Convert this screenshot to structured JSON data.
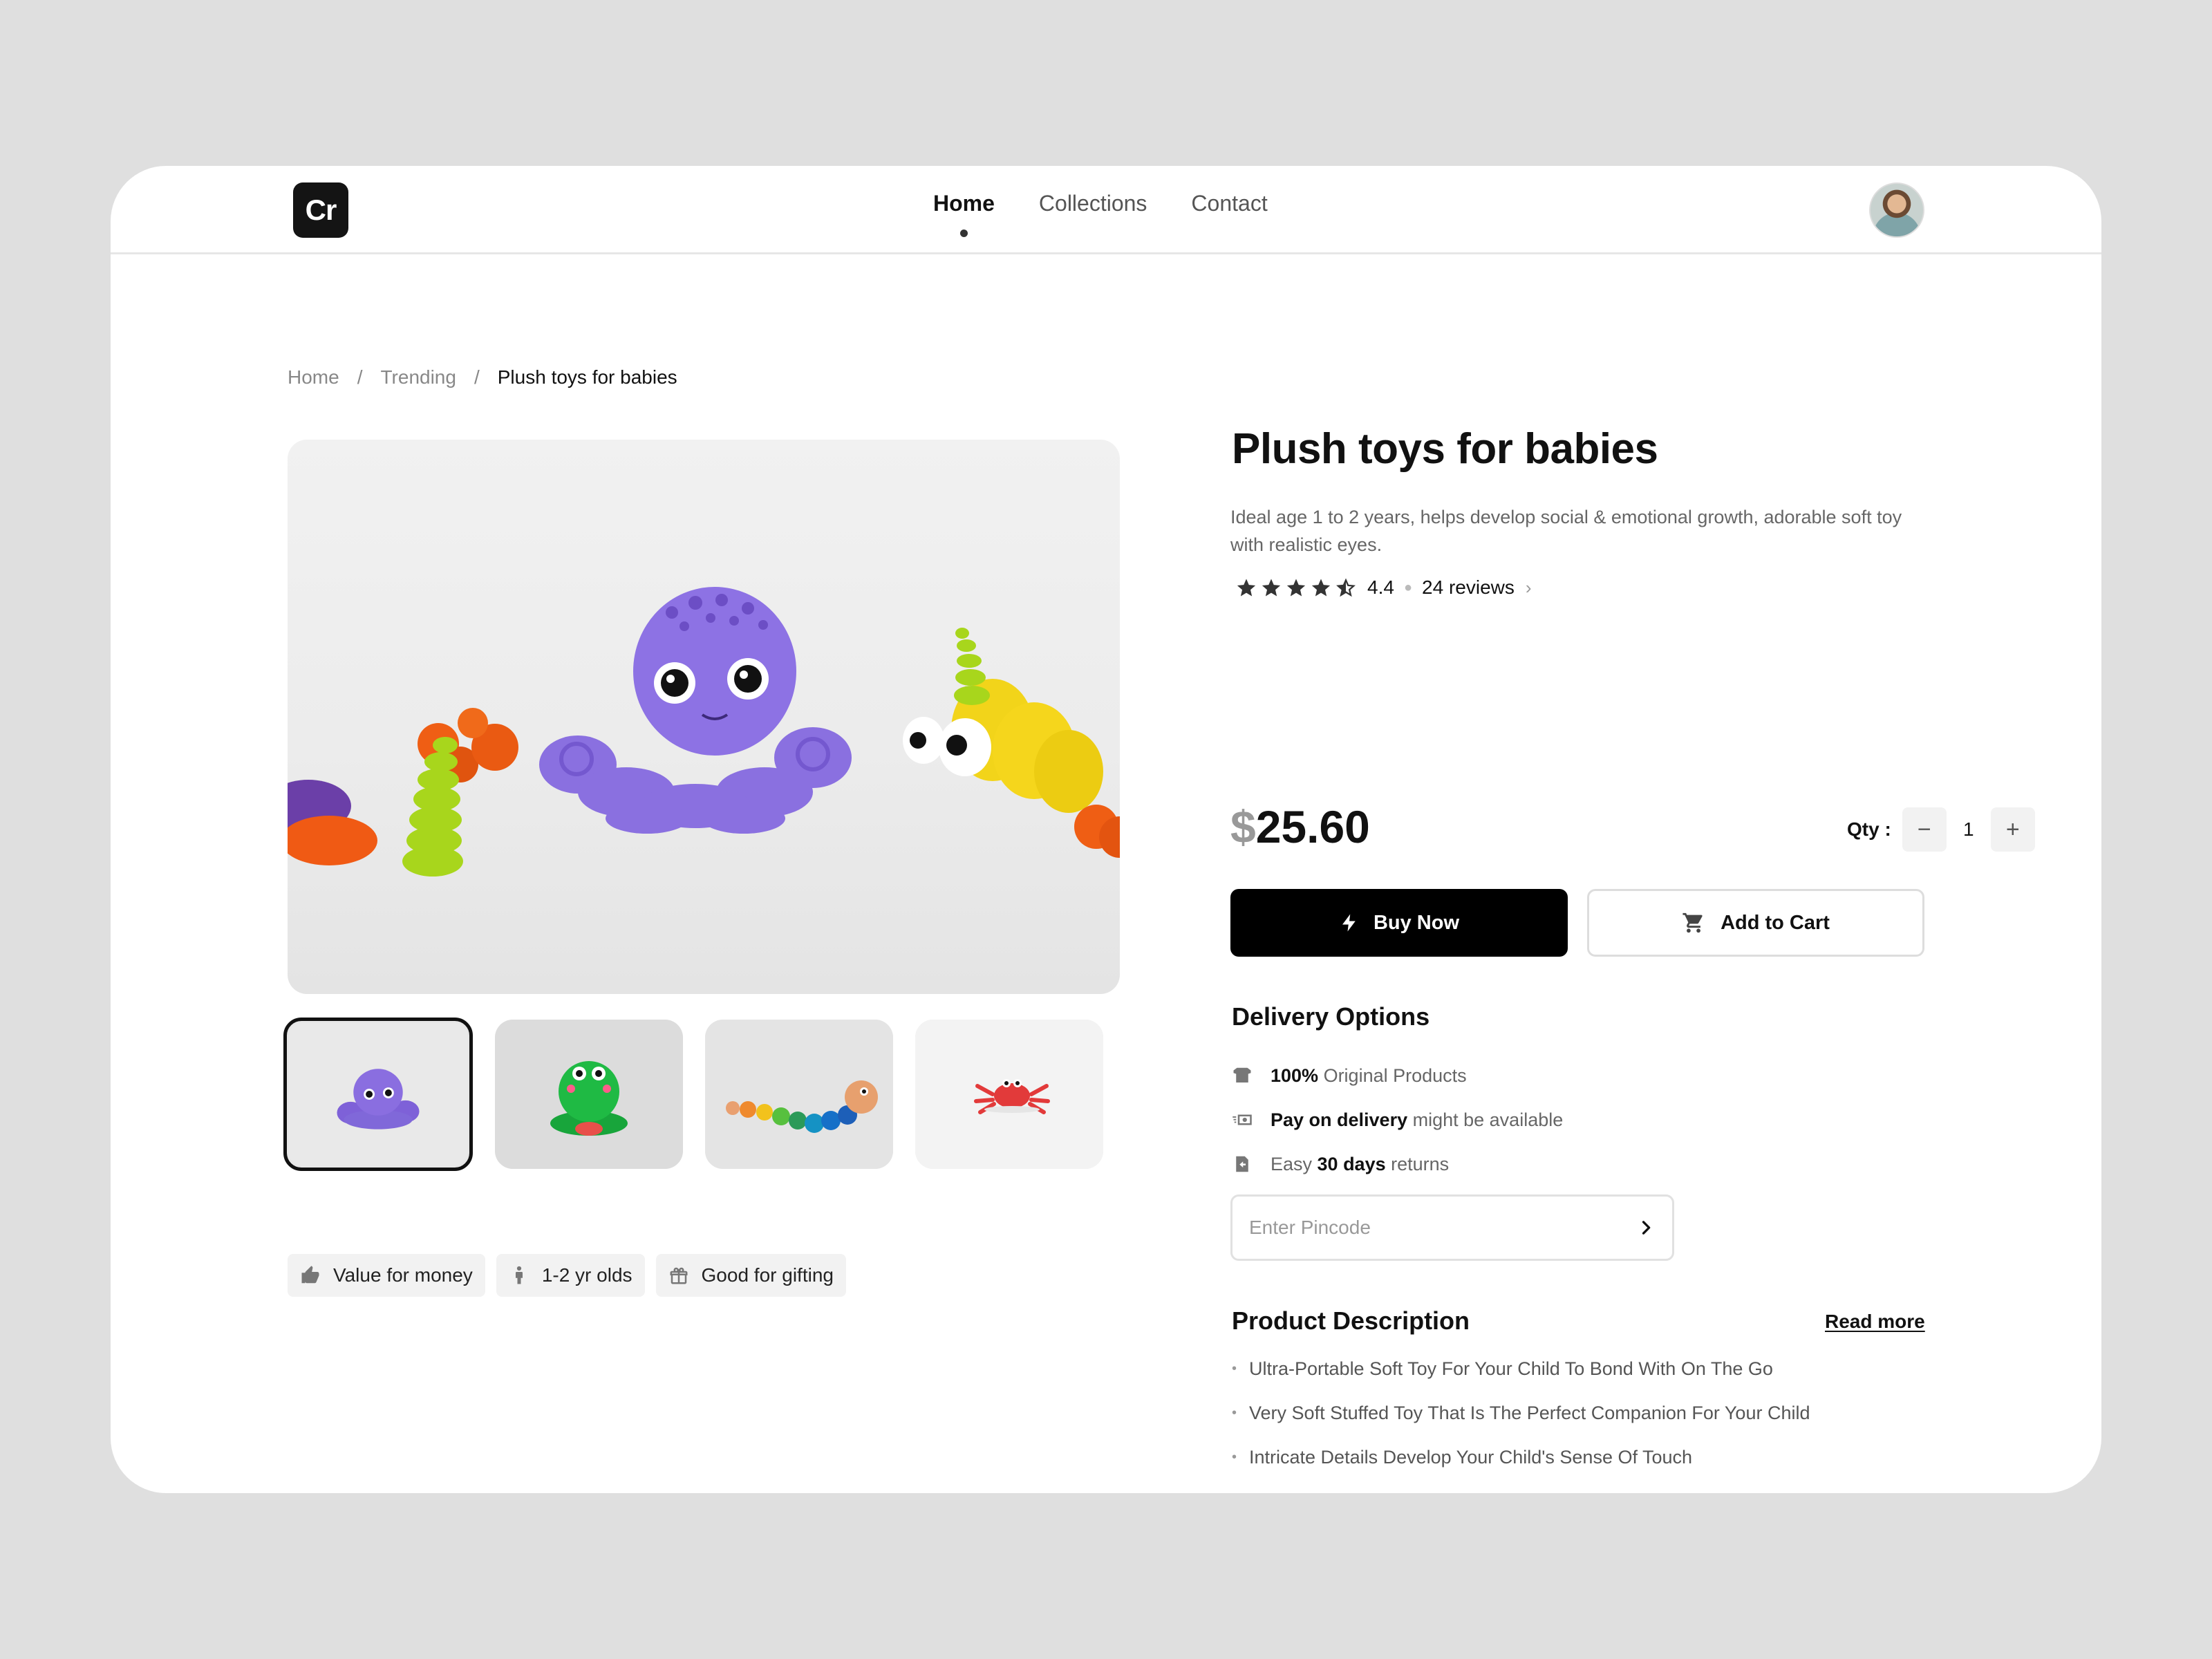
{
  "header": {
    "logo": "Cr",
    "nav": [
      {
        "label": "Home",
        "active": true
      },
      {
        "label": "Collections",
        "active": false
      },
      {
        "label": "Contact",
        "active": false
      }
    ],
    "avatar_icon": "user-avatar"
  },
  "breadcrumb": {
    "items": [
      "Home",
      "Trending",
      "Plush toys for babies"
    ],
    "separator": "/"
  },
  "gallery": {
    "main_image": "purple clay octopus with sea plants and yellow fish",
    "thumbnails": [
      {
        "name": "purple octopus",
        "selected": true
      },
      {
        "name": "green frog",
        "selected": false
      },
      {
        "name": "caterpillar",
        "selected": false
      },
      {
        "name": "red crab",
        "selected": false
      }
    ]
  },
  "tags": [
    {
      "icon": "thumbs-up-icon",
      "label": "Value for money"
    },
    {
      "icon": "child-icon",
      "label": "1-2 yr olds"
    },
    {
      "icon": "gift-icon",
      "label": "Good for gifting"
    }
  ],
  "product": {
    "title": "Plush toys for babies",
    "description": "Ideal age 1 to 2 years, helps develop social & emotional growth, adorable soft toy with realistic eyes.",
    "rating": "4.4",
    "rating_value": 4.5,
    "reviews": "24 reviews",
    "currency": "$",
    "price": "25.60",
    "qty_label": "Qty :",
    "qty": "1",
    "buy_label": "Buy Now",
    "cart_label": "Add to Cart"
  },
  "delivery": {
    "title": "Delivery Options",
    "items": [
      {
        "icon": "box-icon",
        "bold": "100%",
        "text": " Original Products",
        "bold_first": true
      },
      {
        "icon": "cash-icon",
        "bold": "Pay on delivery",
        "text": " might be available",
        "bold_first": true
      },
      {
        "icon": "return-icon",
        "pre": "Easy ",
        "bold": "30 days",
        "text": " returns",
        "bold_first": false
      }
    ],
    "pincode_placeholder": "Enter Pincode"
  },
  "description": {
    "title": "Product Description",
    "read_more": "Read more",
    "bullets": [
      "Ultra-Portable Soft Toy For Your Child To Bond With On The Go",
      "Very Soft Stuffed Toy That Is The Perfect Companion For Your Child",
      "Intricate Details Develop Your Child's Sense Of Touch"
    ]
  },
  "colors": {
    "accent": "#000000",
    "background": "#dfdfdf",
    "card": "#ffffff"
  }
}
